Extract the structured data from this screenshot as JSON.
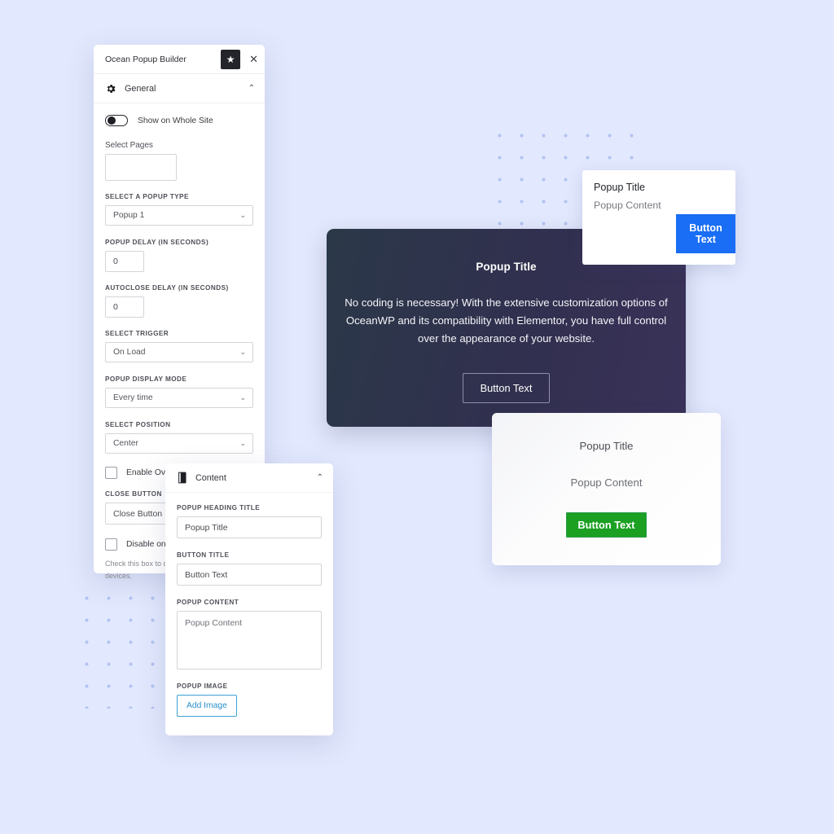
{
  "page": {
    "background_color": "#e2e8fd",
    "accent_blue": "#1a6ef5",
    "accent_green": "#1ba022",
    "dot_color": "#a9bdf0"
  },
  "general_panel": {
    "title": "Ocean Popup Builder",
    "star_icon": "star-icon",
    "close_icon": "close-icon",
    "section": {
      "icon": "gear-icon",
      "label": "General",
      "collapse_icon": "chevron-up-icon"
    },
    "toggle": {
      "label": "Show on Whole Site",
      "state": "off"
    },
    "select_pages": {
      "label": "Select Pages",
      "value": ""
    },
    "popup_type": {
      "label": "SELECT A POPUP TYPE",
      "value": "Popup 1",
      "options": [
        "Popup 1"
      ]
    },
    "popup_delay": {
      "label": "POPUP DELAY (IN SECONDS)",
      "value": "0"
    },
    "autoclose_delay": {
      "label": "AUTOCLOSE DELAY (IN SECONDS)",
      "value": "0"
    },
    "select_trigger": {
      "label": "SELECT TRIGGER",
      "value": "On Load",
      "options": [
        "On Load"
      ]
    },
    "display_mode": {
      "label": "POPUP DISPLAY MODE",
      "value": "Every time",
      "options": [
        "Every time"
      ]
    },
    "select_position": {
      "label": "SELECT POSITION",
      "value": "Center",
      "options": [
        "Center"
      ]
    },
    "enable_overlay": {
      "label": "Enable Overlay:",
      "checked": false
    },
    "close_button": {
      "label": "CLOSE BUTTON",
      "value": "Close Button"
    },
    "disable_on_mobile": {
      "label": "Disable on M",
      "checked": false,
      "helper_line_1": "Check this box to d",
      "helper_line_2": "devices."
    }
  },
  "content_panel": {
    "section": {
      "icon": "book-icon",
      "label": "Content",
      "collapse_icon": "chevron-up-icon"
    },
    "heading_title": {
      "label": "POPUP HEADING TITLE",
      "value": "Popup Title"
    },
    "button_title": {
      "label": "BUTTON TITLE",
      "value": "Button Text"
    },
    "popup_content": {
      "label": "POPUP CONTENT",
      "value": "Popup Content"
    },
    "popup_image": {
      "label": "POPUP IMAGE",
      "button_label": "Add Image"
    }
  },
  "preview_dark": {
    "title": "Popup Title",
    "body": "No coding is necessary! With the extensive customization options of OceanWP and its compatibility with Elementor, you have full control over the appearance of your website.",
    "button_label": "Button Text"
  },
  "preview_blue": {
    "title": "Popup Title",
    "content": "Popup Content",
    "button_label": "Button Text"
  },
  "preview_green": {
    "title": "Popup Title",
    "content": "Popup Content",
    "button_label": "Button Text"
  }
}
